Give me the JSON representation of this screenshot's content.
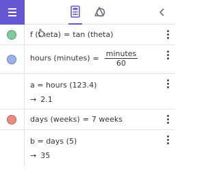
{
  "toolbar": {
    "menu_icon": "hamburger-menu-icon",
    "tabs": [
      {
        "icon": "calculator-icon",
        "selected": true
      },
      {
        "icon": "geometry-tools-icon",
        "selected": false
      }
    ],
    "collapse_icon": "chevron-left-icon",
    "accent_color": "#6557d2"
  },
  "rows": [
    {
      "marble_color": "#7ecb9b",
      "expr": {
        "lhs": "f (theta)",
        "eq": "=",
        "rhs": "tan (theta)"
      }
    },
    {
      "marble_color": "#99b2ed",
      "expr": {
        "lhs": "hours (minutes)",
        "eq": "=",
        "num": "minutes",
        "den": "60"
      }
    },
    {
      "marble_color": "",
      "expr": {
        "text": "a = hours (123.4)"
      },
      "output": {
        "arrow": "→",
        "value": "2.1"
      }
    },
    {
      "marble_color": "#f08a80",
      "expr": {
        "lhs": "days (weeks)",
        "eq": "=",
        "rhs": "7 weeks"
      }
    },
    {
      "marble_color": "",
      "expr": {
        "text": "b = days (5)"
      },
      "output": {
        "arrow": "→",
        "value": "35"
      }
    }
  ]
}
